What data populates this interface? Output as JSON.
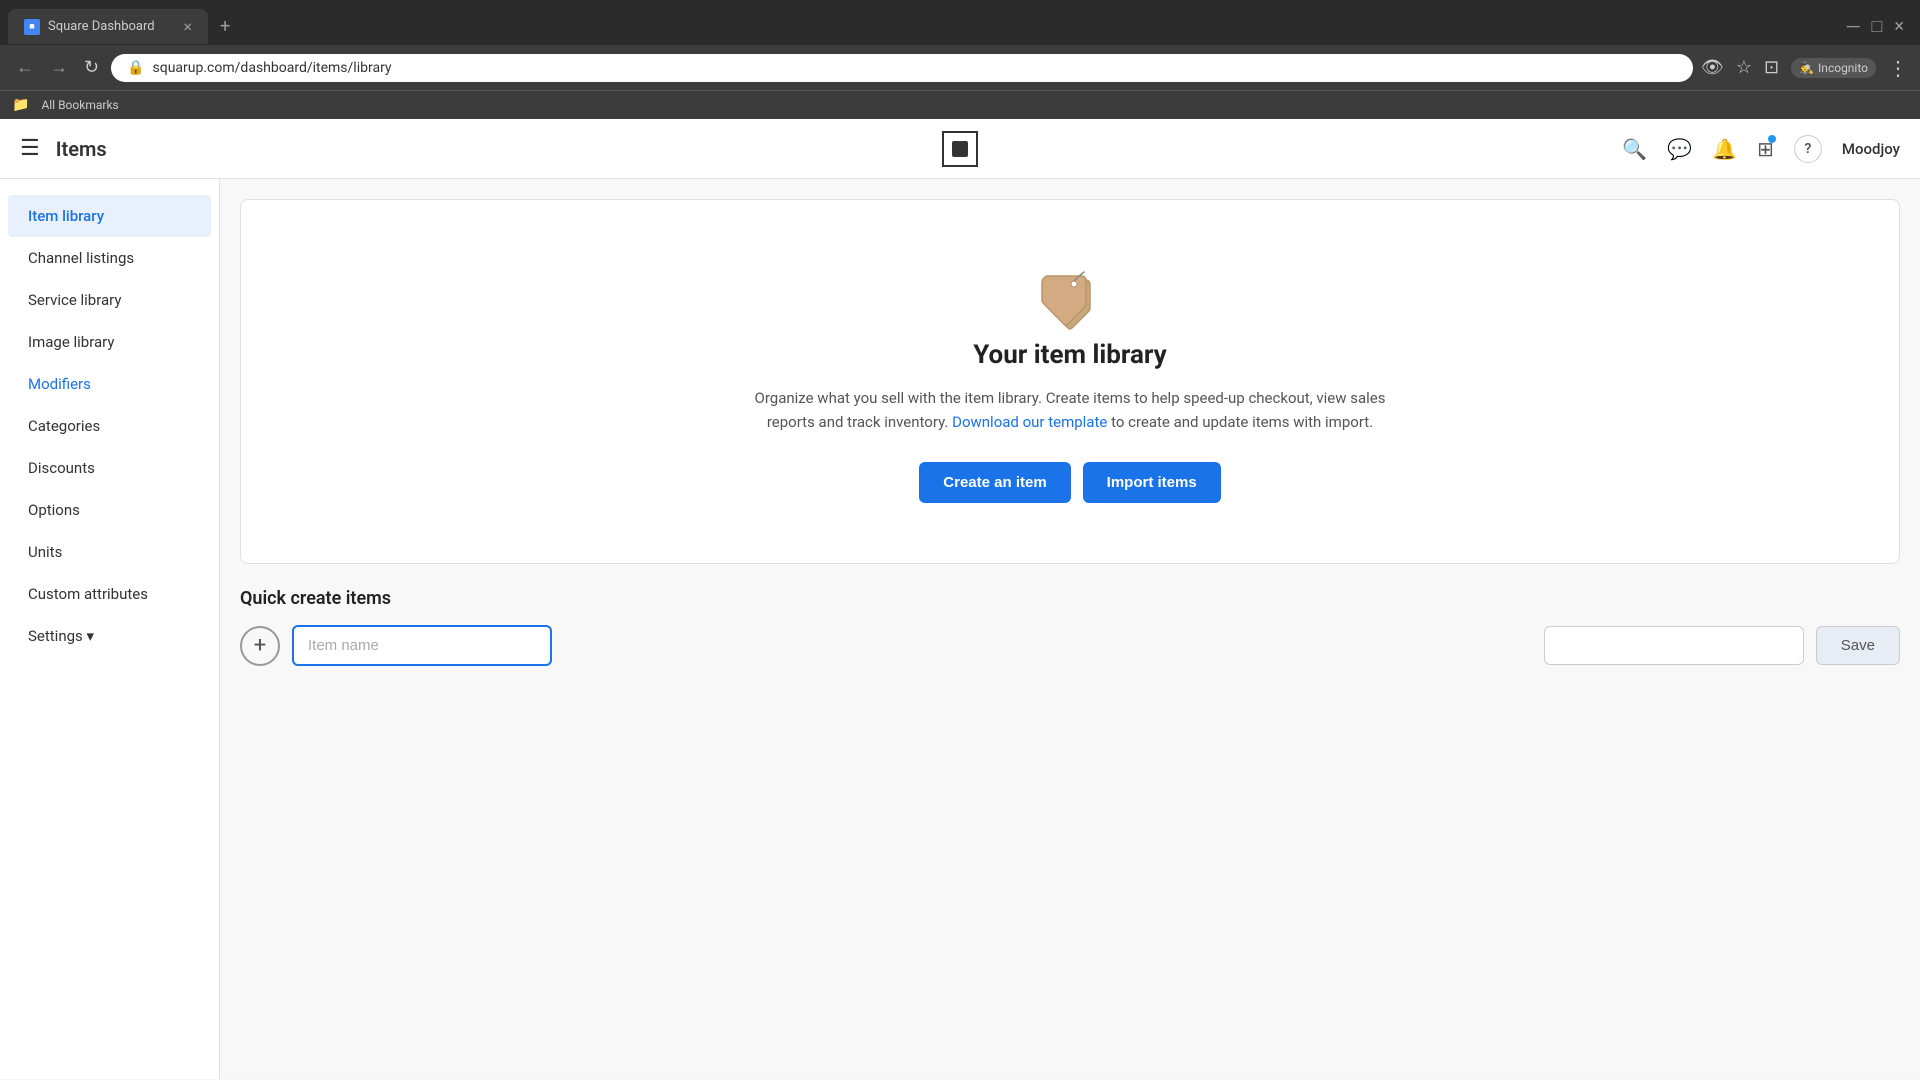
{
  "browser": {
    "tab_title": "Square Dashboard",
    "tab_close": "×",
    "tab_new": "+",
    "address": "squarup.com/dashboard/items/library",
    "incognito_label": "Incognito",
    "bookmarks_bar_label": "All Bookmarks"
  },
  "nav": {
    "hamburger": "☰",
    "app_title": "Items",
    "user_name": "Moodjoy",
    "icons": {
      "search": "🔍",
      "chat": "💬",
      "bell": "🔔",
      "grid": "⊞",
      "help": "?"
    }
  },
  "sidebar": {
    "items": [
      {
        "id": "item-library",
        "label": "Item library",
        "active": true
      },
      {
        "id": "channel-listings",
        "label": "Channel listings",
        "active": false
      },
      {
        "id": "service-library",
        "label": "Service library",
        "active": false
      },
      {
        "id": "image-library",
        "label": "Image library",
        "active": false
      },
      {
        "id": "modifiers",
        "label": "Modifiers",
        "active": false
      },
      {
        "id": "categories",
        "label": "Categories",
        "active": false
      },
      {
        "id": "discounts",
        "label": "Discounts",
        "active": false
      },
      {
        "id": "options",
        "label": "Options",
        "active": false
      },
      {
        "id": "units",
        "label": "Units",
        "active": false
      },
      {
        "id": "custom-attributes",
        "label": "Custom attributes",
        "active": false
      },
      {
        "id": "settings",
        "label": "Settings ▾",
        "active": false
      }
    ]
  },
  "hero": {
    "title": "Your item library",
    "description_prefix": "Organize what you sell with the item library. Create items to help speed-up checkout, view sales reports and track inventory.",
    "download_link_text": "Download our template",
    "description_suffix": "to create and update items with import.",
    "create_btn": "Create an item",
    "import_btn": "Import items"
  },
  "quick_create": {
    "title": "Quick create items",
    "add_btn": "+",
    "input_placeholder": "Item name",
    "save_btn": "Save"
  }
}
